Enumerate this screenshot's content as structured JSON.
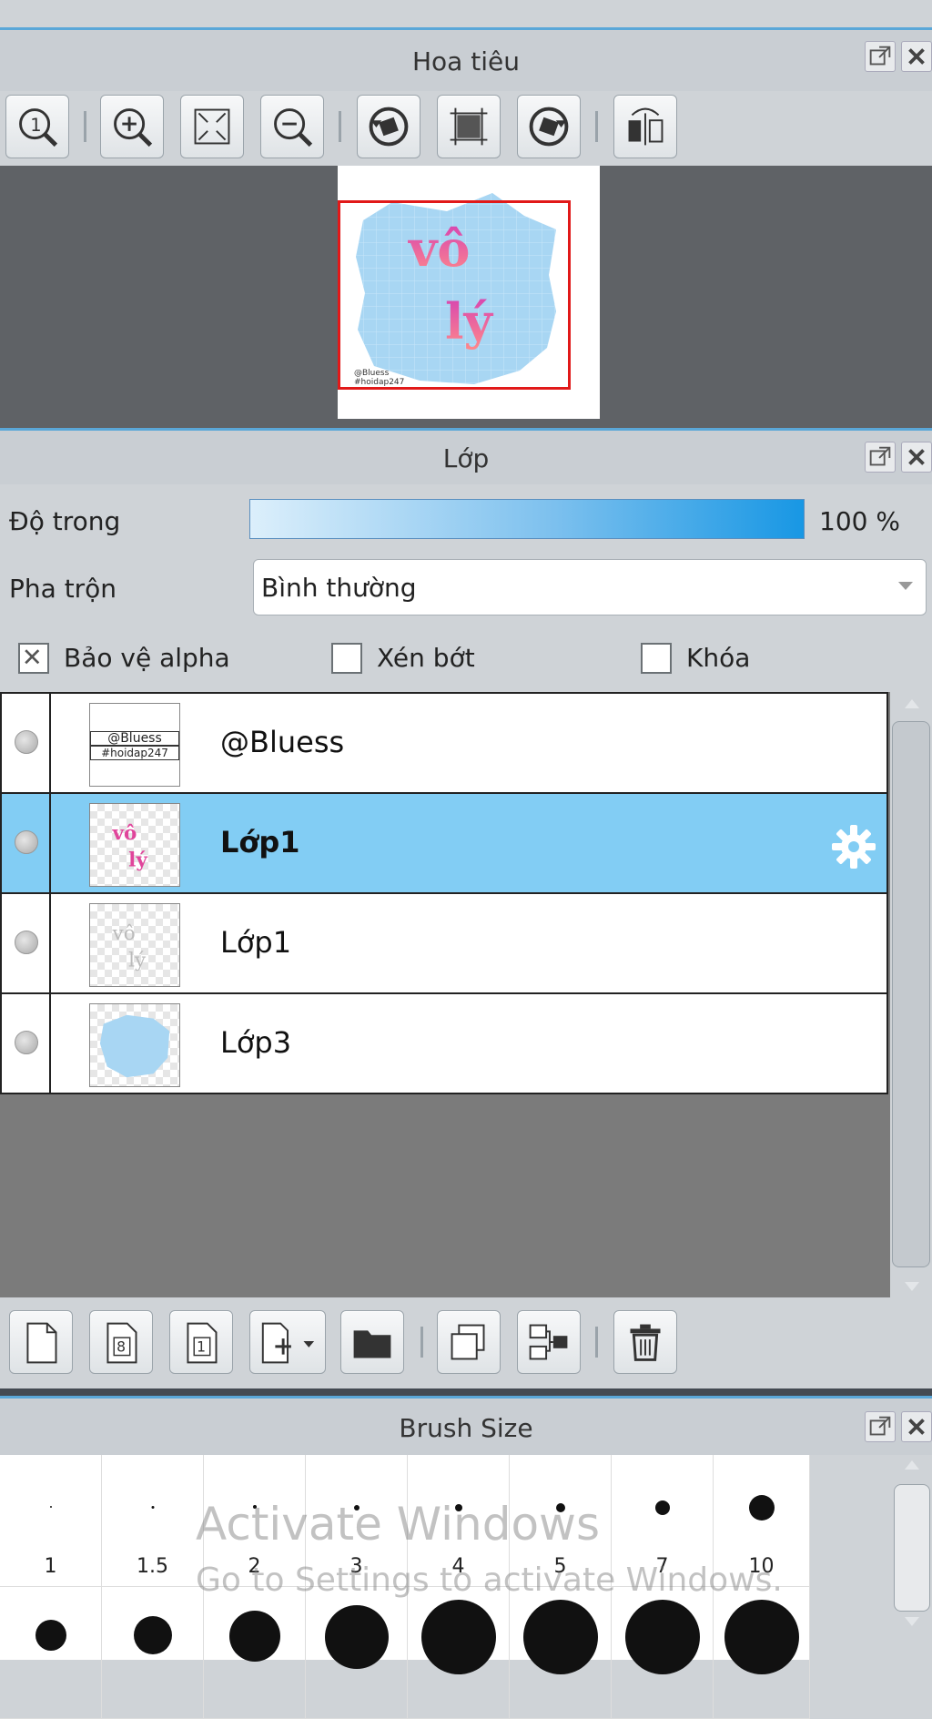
{
  "navigator": {
    "title": "Hoa tiêu",
    "tools": [
      "zoom-actual-icon",
      "zoom-in-icon",
      "fit-screen-icon",
      "zoom-out-icon",
      "rotate-left-icon",
      "reset-rotation-icon",
      "rotate-right-icon",
      "flip-horizontal-icon"
    ],
    "preview": {
      "word1": "vô",
      "word2": "lý",
      "credit_line1": "@Bluess",
      "credit_line2": "#hoidap247"
    }
  },
  "layers_panel": {
    "title": "Lớp",
    "opacity_label": "Độ trong",
    "opacity_value": "100 %",
    "opacity_fraction": 1.0,
    "blend_label": "Pha trộn",
    "blend_value": "Bình thường",
    "protect_alpha_label": "Bảo vệ alpha",
    "protect_alpha_checked": true,
    "clipping_label": "Xén bớt",
    "clipping_checked": false,
    "lock_label": "Khóa",
    "lock_checked": false,
    "layers": [
      {
        "name": "@Bluess",
        "thumb_text1": "@Bluess",
        "thumb_text2": "#hoidap247",
        "selected": false
      },
      {
        "name": "Lớp1",
        "selected": true
      },
      {
        "name": "Lớp1",
        "selected": false
      },
      {
        "name": "Lớp3",
        "selected": false
      }
    ],
    "bottom_tools": [
      "new-layer-icon",
      "new-8bit-layer-icon",
      "new-1bit-layer-icon",
      "add-layer-dropdown-icon",
      "folder-icon",
      "duplicate-layer-icon",
      "merge-layer-icon",
      "delete-layer-icon"
    ]
  },
  "brush_size": {
    "title": "Brush Size",
    "sizes_row1": [
      "1",
      "1.5",
      "2",
      "3",
      "4",
      "5",
      "7",
      "10"
    ]
  },
  "watermark": {
    "line1": "Activate Windows",
    "line2": "Go to Settings to activate Windows."
  },
  "colors": {
    "accent_blue": "#5aa7d8",
    "selected_row": "#82cdf4",
    "canvas_blue": "#a8d6f3",
    "text_pink": "#e0459b"
  }
}
